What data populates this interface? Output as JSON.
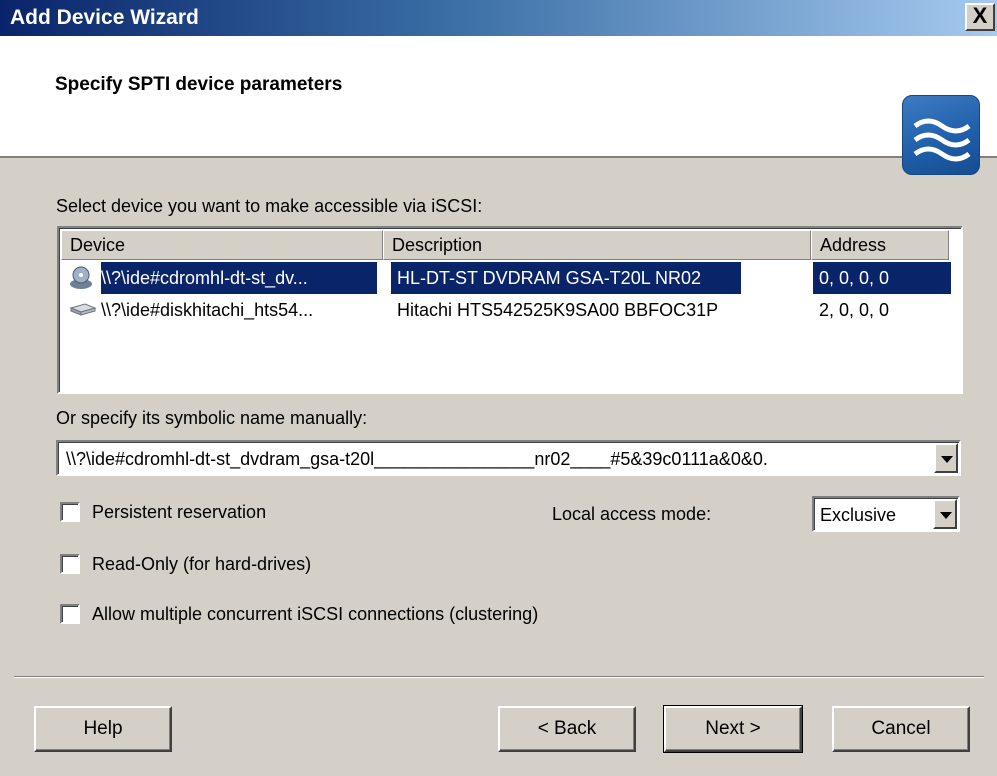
{
  "window": {
    "title": "Add Device Wizard",
    "close_label": "X"
  },
  "header": {
    "heading": "Specify SPTI device parameters"
  },
  "device_list": {
    "label": "Select device you want to make accessible via iSCSI:",
    "columns": [
      "Device",
      "Description",
      "Address"
    ],
    "rows": [
      {
        "icon": "cd-drive-icon",
        "device": "\\\\?\\ide#cdromhl-dt-st_dv...",
        "description": "HL-DT-ST DVDRAM GSA-T20L NR02",
        "address": "0, 0, 0, 0",
        "selected": true
      },
      {
        "icon": "hard-disk-icon",
        "device": "\\\\?\\ide#diskhitachi_hts54...",
        "description": "Hitachi HTS542525K9SA00 BBFOC31P",
        "address": "2, 0, 0, 0",
        "selected": false
      }
    ]
  },
  "symbolic_name": {
    "label": "Or specify its symbolic name manually:",
    "value": "\\\\?\\ide#cdromhl-dt-st_dvdram_gsa-t20l________________nr02____#5&39c0111a&0&0."
  },
  "options": {
    "persistent_reservation": {
      "label": "Persistent reservation",
      "checked": false
    },
    "read_only": {
      "label": "Read-Only  (for hard-drives)",
      "checked": false
    },
    "allow_multiple": {
      "label": "Allow multiple concurrent iSCSI connections (clustering)",
      "checked": false
    }
  },
  "local_access": {
    "label": "Local access mode:",
    "value": "Exclusive"
  },
  "buttons": {
    "help": "Help",
    "back": "< Back",
    "next": "Next >",
    "cancel": "Cancel"
  },
  "colors": {
    "selection": "#0a246a",
    "face": "#d4d0c8"
  }
}
